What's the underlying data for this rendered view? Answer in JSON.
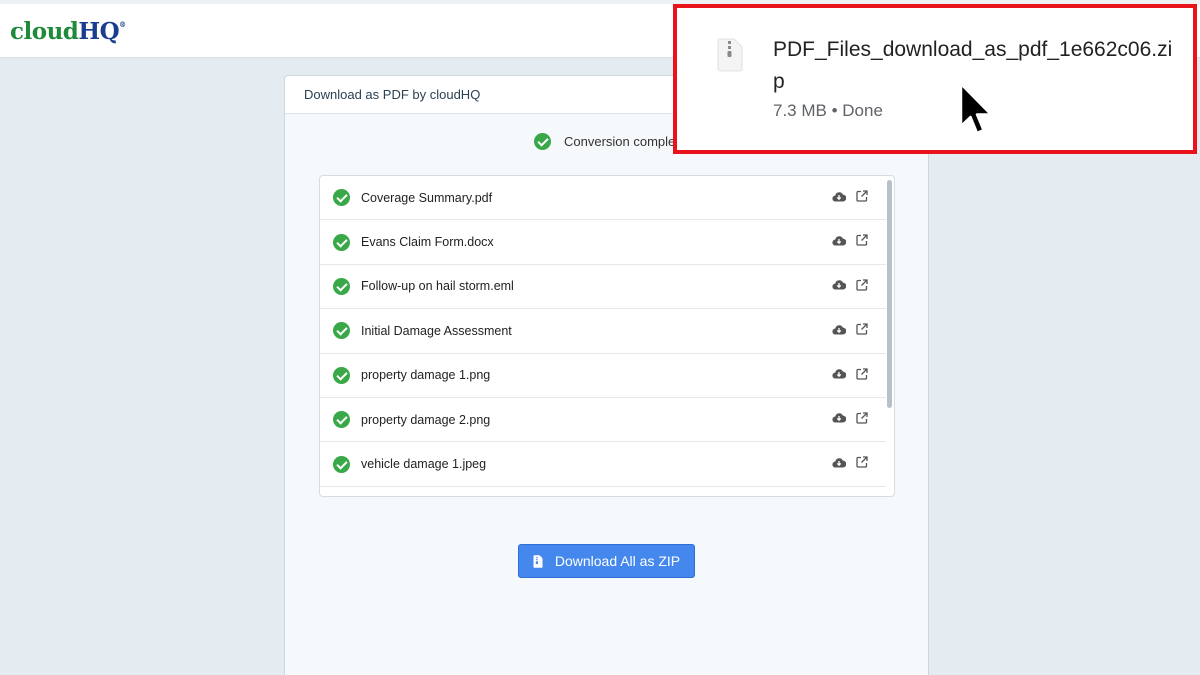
{
  "header": {
    "logo_part1": "cloud",
    "logo_part2": "HQ",
    "logo_mark": "®"
  },
  "panel": {
    "title": "Download as PDF by cloudHQ",
    "status_text": "Conversion complete",
    "files": [
      {
        "name": "Coverage Summary.pdf"
      },
      {
        "name": "Evans Claim Form.docx"
      },
      {
        "name": "Follow-up on hail storm.eml"
      },
      {
        "name": "Initial Damage Assessment"
      },
      {
        "name": "property damage 1.png"
      },
      {
        "name": "property damage 2.png"
      },
      {
        "name": "vehicle damage 1.jpeg"
      }
    ],
    "row_icons": [
      "cloud-download-icon",
      "external-link-icon"
    ],
    "download_all_label": "Download All as ZIP"
  },
  "download_popup": {
    "file_name": "PDF_Files_download_as_pdf_1e662c06.zip",
    "size": "7.3 MB",
    "separator": "•",
    "status": "Done"
  },
  "colors": {
    "success": "#39a848",
    "primary_button": "#4488ee",
    "highlight_border": "#e8131b",
    "logo_green": "#1f8a3b",
    "logo_blue": "#1a3d8f"
  }
}
